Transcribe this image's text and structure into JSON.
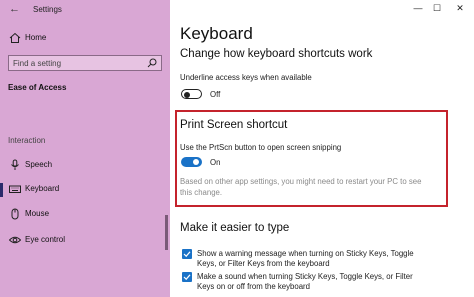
{
  "window": {
    "title": "Settings",
    "minimize_glyph": "—",
    "maximize_glyph": "☐",
    "close_glyph": "✕"
  },
  "sidebar": {
    "back_glyph": "←",
    "home_label": "Home",
    "search_placeholder": "Find a setting",
    "section_title": "Ease of Access",
    "group_label": "Interaction",
    "items": [
      {
        "label": "Speech",
        "icon": "microphone-icon"
      },
      {
        "label": "Keyboard",
        "icon": "keyboard-icon",
        "active": true
      },
      {
        "label": "Mouse",
        "icon": "mouse-icon"
      },
      {
        "label": "Eye control",
        "icon": "eye-icon"
      }
    ]
  },
  "main": {
    "title": "Keyboard",
    "shortcuts_heading": "Change how keyboard shortcuts work",
    "underline_label": "Underline access keys when available",
    "underline_state": "Off",
    "print_screen_heading": "Print Screen shortcut",
    "prtscn_label": "Use the PrtScn button to open screen snipping",
    "prtscn_state": "On",
    "restart_note_line1": "Based on other app settings, you might need to restart your PC to see",
    "restart_note_line2": "this change.",
    "easier_heading": "Make it easier to type",
    "checkbox1_line1": "Show a warning message when turning on Sticky Keys, Toggle",
    "checkbox1_line2": "Keys, or Filter Keys from the keyboard",
    "checkbox2_line1": "Make a sound when turning Sticky Keys, Toggle Keys, or Filter",
    "checkbox2_line2": "Keys on or off from the keyboard"
  },
  "colors": {
    "sidebar_bg": "#d9a7d4",
    "accent": "#1a72c7",
    "highlight_border": "#c4232c"
  }
}
